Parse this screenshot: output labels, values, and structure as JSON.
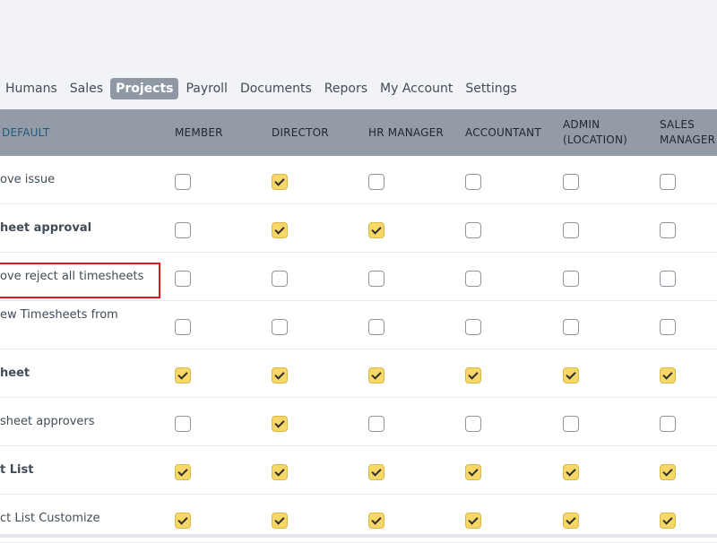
{
  "nav": {
    "items": [
      {
        "label": "Humans",
        "active": false
      },
      {
        "label": "Sales",
        "active": false
      },
      {
        "label": "Projects",
        "active": true
      },
      {
        "label": "Payroll",
        "active": false
      },
      {
        "label": "Documents",
        "active": false
      },
      {
        "label": "Repors",
        "active": false
      },
      {
        "label": "My Account",
        "active": false
      },
      {
        "label": "Settings",
        "active": false
      }
    ]
  },
  "table": {
    "columns": [
      {
        "label": "DEFAULT"
      },
      {
        "label": "MEMBER"
      },
      {
        "label": "DIRECTOR"
      },
      {
        "label": "HR MANAGER"
      },
      {
        "label": "ACCOUNTANT"
      },
      {
        "label_lines": [
          "ADMIN",
          "(LOCATION)"
        ]
      },
      {
        "label_lines": [
          "SALES",
          "MANAGER"
        ]
      }
    ],
    "rows": [
      {
        "label_lines": [
          "ove issue"
        ],
        "bold": false,
        "checks": [
          false,
          true,
          false,
          false,
          false,
          false
        ]
      },
      {
        "label_lines": [
          "heet approval"
        ],
        "bold": true,
        "checks": [
          false,
          true,
          true,
          false,
          false,
          false
        ]
      },
      {
        "label_lines": [
          "ove reject all timesheets"
        ],
        "bold": false,
        "highlighted": true,
        "checks": [
          false,
          false,
          false,
          false,
          false,
          false
        ]
      },
      {
        "label_lines": [
          "ew Timesheets from",
          ""
        ],
        "bold": false,
        "checks": [
          false,
          false,
          false,
          false,
          false,
          false
        ]
      },
      {
        "label_lines": [
          "heet"
        ],
        "bold": true,
        "checks": [
          true,
          true,
          true,
          true,
          true,
          true
        ]
      },
      {
        "label_lines": [
          "sheet approvers"
        ],
        "bold": false,
        "checks": [
          false,
          true,
          false,
          false,
          false,
          false
        ]
      },
      {
        "label_lines": [
          "t List"
        ],
        "bold": true,
        "checks": [
          true,
          true,
          true,
          true,
          true,
          true
        ]
      },
      {
        "label_lines": [
          "ct List Customize"
        ],
        "bold": false,
        "checks": [
          true,
          true,
          true,
          true,
          true,
          true
        ]
      }
    ]
  },
  "colors": {
    "active_tab_bg": "#8f99a5",
    "header_bg": "#939ca6",
    "checkbox_checked": "#f6d767",
    "highlight_border": "#e0161d"
  }
}
